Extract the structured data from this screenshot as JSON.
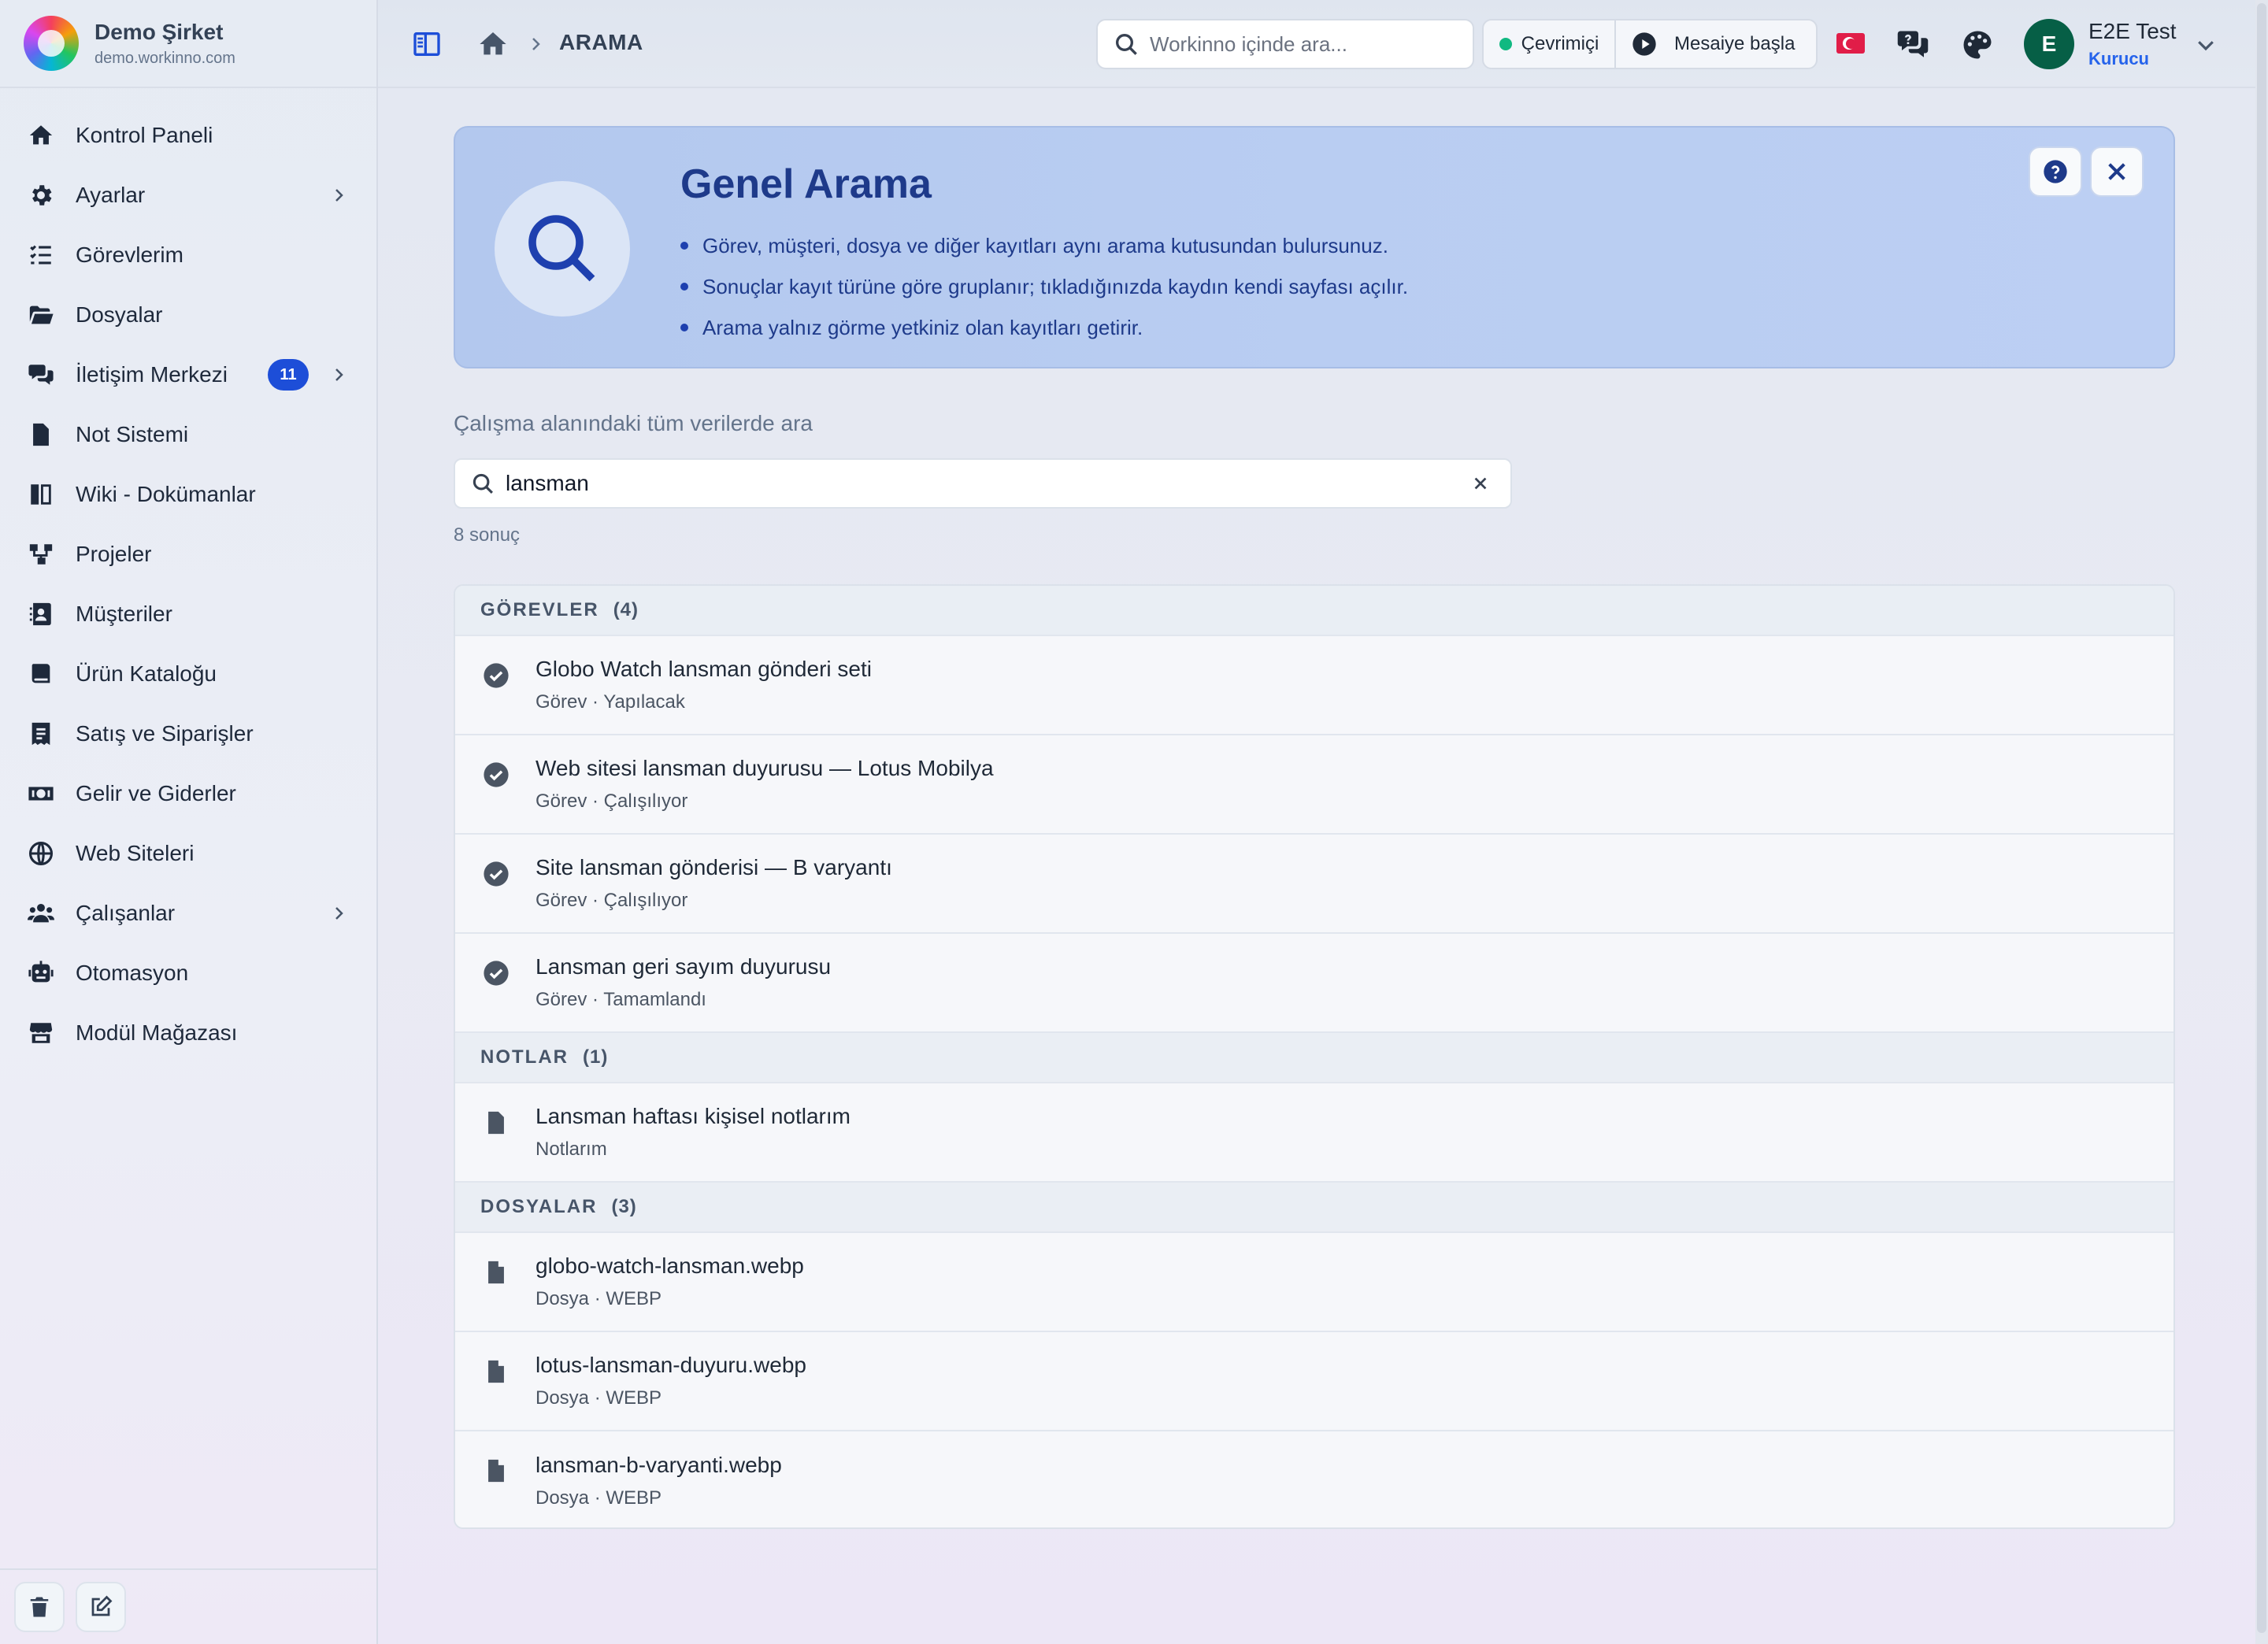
{
  "sidebar": {
    "brand_name": "Demo Şirket",
    "brand_domain": "demo.workinno.com",
    "items": [
      {
        "label": "Kontrol Paneli",
        "icon": "home-icon"
      },
      {
        "label": "Ayarlar",
        "icon": "gear-icon",
        "has_children": true
      },
      {
        "label": "Görevlerim",
        "icon": "list-check-icon"
      },
      {
        "label": "Dosyalar",
        "icon": "folder-open-icon"
      },
      {
        "label": "İletişim Merkezi",
        "icon": "comments-icon",
        "badge": "11",
        "has_children": true
      },
      {
        "label": "Not Sistemi",
        "icon": "file-text-icon"
      },
      {
        "label": "Wiki - Dokümanlar",
        "icon": "book-icon"
      },
      {
        "label": "Projeler",
        "icon": "diagram-icon"
      },
      {
        "label": "Müşteriler",
        "icon": "contact-card-icon"
      },
      {
        "label": "Ürün Kataloğu",
        "icon": "catalog-book-icon"
      },
      {
        "label": "Satış ve Siparişler",
        "icon": "receipt-icon"
      },
      {
        "label": "Gelir ve Giderler",
        "icon": "money-icon"
      },
      {
        "label": "Web Siteleri",
        "icon": "globe-icon"
      },
      {
        "label": "Çalışanlar",
        "icon": "users-icon",
        "has_children": true
      },
      {
        "label": "Otomasyon",
        "icon": "robot-icon"
      },
      {
        "label": "Modül Mağazası",
        "icon": "store-icon"
      }
    ]
  },
  "topbar": {
    "breadcrumb": "ARAMA",
    "search_placeholder": "Workinno içinde ara...",
    "status_label": "Çevrimiçi",
    "shift_label": "Mesaiye başla",
    "user_initial": "E",
    "user_name": "E2E Test",
    "user_role": "Kurucu"
  },
  "banner": {
    "title": "Genel Arama",
    "bullets": [
      "Görev, müşteri, dosya ve diğer kayıtları aynı arama kutusundan bulursunuz.",
      "Sonuçlar kayıt türüne göre gruplanır; tıkladığınızda kaydın kendi sayfası açılır.",
      "Arama yalnız görme yetkiniz olan kayıtları getirir."
    ]
  },
  "search": {
    "label": "Çalışma alanındaki tüm verilerde ara",
    "query": "lansman",
    "result_count": "8 sonuç"
  },
  "groups": [
    {
      "title": "GÖREVLER",
      "count": "(4)",
      "icon": "check-circle-icon",
      "items": [
        {
          "title": "Globo Watch lansman gönderi seti",
          "sub": "Görev · Yapılacak"
        },
        {
          "title": "Web sitesi lansman duyurusu — Lotus Mobilya",
          "sub": "Görev · Çalışılıyor"
        },
        {
          "title": "Site lansman gönderisi — B varyantı",
          "sub": "Görev · Çalışılıyor"
        },
        {
          "title": "Lansman geri sayım duyurusu",
          "sub": "Görev · Tamamlandı"
        }
      ]
    },
    {
      "title": "NOTLAR",
      "count": "(1)",
      "icon": "note-icon",
      "items": [
        {
          "title": "Lansman haftası kişisel notlarım",
          "sub": "Notlarım"
        }
      ]
    },
    {
      "title": "DOSYALAR",
      "count": "(3)",
      "icon": "file-icon",
      "items": [
        {
          "title": "globo-watch-lansman.webp",
          "sub": "Dosya · WEBP"
        },
        {
          "title": "lotus-lansman-duyuru.webp",
          "sub": "Dosya · WEBP"
        },
        {
          "title": "lansman-b-varyanti.webp",
          "sub": "Dosya · WEBP"
        }
      ]
    }
  ],
  "colors": {
    "accent": "#1d4ed8",
    "online": "#10b981",
    "avatar": "#065f46"
  }
}
